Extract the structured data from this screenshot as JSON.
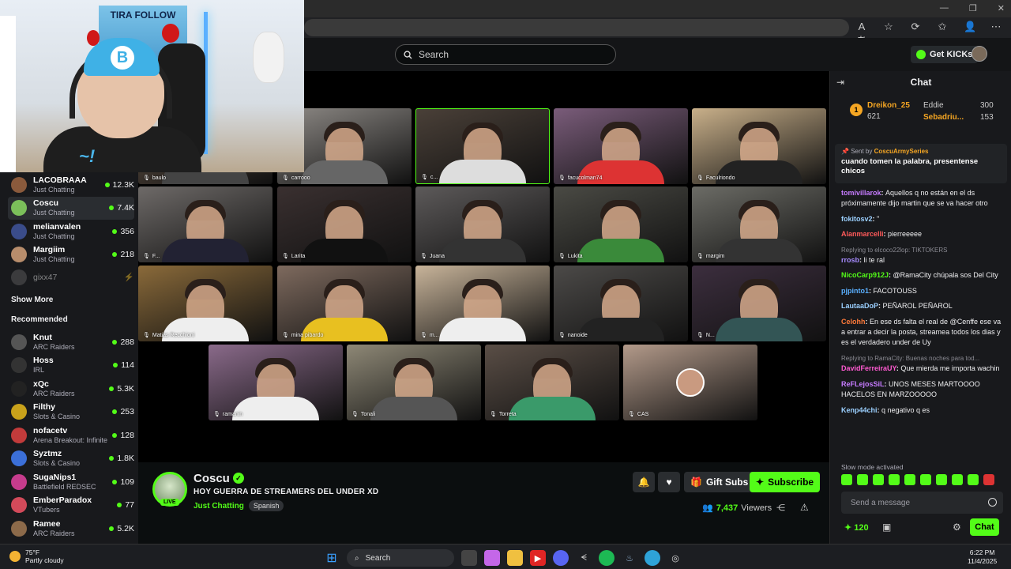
{
  "browser": {
    "window_controls": [
      "—",
      "❐",
      "✕"
    ],
    "icons": [
      "Aあ",
      "☆",
      "⟳",
      "✩",
      "👤",
      "⋯"
    ]
  },
  "topbar": {
    "search_placeholder": "Search",
    "get_kicks": "Get KICKs"
  },
  "webcam": {
    "banner": "TIRA FOLLOW",
    "cap_letter": "B"
  },
  "sidebar": {
    "following": [
      {
        "name": "LACOBRAAA",
        "category": "Just Chatting",
        "viewers": "12.3K",
        "color": "#8a5a3c"
      },
      {
        "name": "Coscu",
        "category": "Just Chatting",
        "viewers": "7.4K",
        "color": "#7bbf5a",
        "active": true
      },
      {
        "name": "melianvalen",
        "category": "Just Chatting",
        "viewers": "356",
        "color": "#3a4c8a"
      },
      {
        "name": "Margiim",
        "category": "Just Chatting",
        "viewers": "218",
        "color": "#b88d6c"
      }
    ],
    "offline": {
      "name": "gixx47"
    },
    "show_more": "Show More",
    "recommended_label": "Recommended",
    "recommended": [
      {
        "name": "Knut",
        "category": "ARC Raiders",
        "viewers": "288",
        "color": "#555"
      },
      {
        "name": "Hoss",
        "category": "IRL",
        "viewers": "114",
        "color": "#333"
      },
      {
        "name": "xQc",
        "category": "ARC Raiders",
        "viewers": "5.3K",
        "color": "#222"
      },
      {
        "name": "Filthy",
        "category": "Slots & Casino",
        "viewers": "253",
        "color": "#c9a21b"
      },
      {
        "name": "nofacetv",
        "category": "Arena Breakout: Infinite",
        "viewers": "128",
        "color": "#c23b3b"
      },
      {
        "name": "Syztmz",
        "category": "Slots & Casino",
        "viewers": "1.8K",
        "color": "#3b6fd8"
      },
      {
        "name": "SugaNips1",
        "category": "Battlefield REDSEC",
        "viewers": "109",
        "color": "#c63c8d"
      },
      {
        "name": "EmberParadox",
        "category": "VTubers",
        "viewers": "77",
        "color": "#d24a5a"
      },
      {
        "name": "Ramee",
        "category": "ARC Raiders",
        "viewers": "5.2K",
        "color": "#8c6a4a"
      }
    ]
  },
  "call": {
    "participants": [
      "baulo",
      "carrooo",
      "c...",
      "facucolman74",
      "Faculriondo",
      "F...",
      "Larita",
      "Juana",
      "Lukita",
      "margim",
      "Matias Recchioni",
      "mina pibardo",
      "m...",
      "nanoide",
      "N...",
      "ramanin",
      "Tonali",
      "Torreta",
      "CAS"
    ]
  },
  "stream": {
    "channel": "Coscu",
    "live": "LIVE",
    "title": "HOY GUERRA DE STREAMERS DEL UNDER XD",
    "category": "Just Chatting",
    "language": "Spanish",
    "gift_subs": "Gift Subs",
    "subscribe": "Subscribe",
    "viewers": "7,437",
    "viewers_label": "Viewers"
  },
  "chat": {
    "title": "Chat",
    "leaderboard": [
      {
        "name": "Dreikon_25",
        "value": "621",
        "color": "#f5a623"
      },
      {
        "name": "Eddie",
        "value": "300",
        "color": "#adadb8"
      },
      {
        "name": "Sebadriu...",
        "value": "153",
        "color": "#f5a623"
      }
    ],
    "pinned": {
      "sent_by": "Sent by",
      "author": "CoscuArmySeries",
      "text": "cuando tomen la palabra, presentense chicos"
    },
    "messages": [
      {
        "user": "tomivillarok",
        "color": "#c67bff",
        "text": "Aquellos q no están en el ds próximamente dijo martin que se va hacer otro"
      },
      {
        "user": "fokitosv2",
        "color": "#9bd0ff",
        "text": "\""
      },
      {
        "user": "Alanmarcelli",
        "color": "#ff5a5a",
        "text": "pierreeeee"
      },
      {
        "reply": "Replying to elcoco22lop: TIKTOKERS",
        "user": "rrosb",
        "color": "#a78bff",
        "text": "li te ral"
      },
      {
        "user": "NicoCarp912J",
        "color": "#53fc18",
        "text": "@RamaCity chúpala sos Del City"
      },
      {
        "user": "pjpinto1",
        "color": "#5ab0ff",
        "text": "FACOTOUSS"
      },
      {
        "user": "LautaaDoP",
        "color": "#9bd0ff",
        "text": "PEÑAROL PEÑAROL"
      },
      {
        "user": "Celohh",
        "color": "#ff7a3a",
        "text": "En ese ds falta el real de @Cenffe ese va a entrar a decir la posta, streamea todos los dias y es el verdadero under de Uy"
      },
      {
        "reply": "Replying to RamaCity: Buenas noches para tod...",
        "user": "DavidFerreiraUY",
        "color": "#ff5ad1",
        "text": "Que mierda me importa wachin"
      },
      {
        "user": "ReFLejosSiL",
        "color": "#c67bff",
        "text": "UNOS MESES MARTOOOO HACELOS EN MARZOOOOO"
      },
      {
        "user": "Kenp44chi",
        "color": "#9bd0ff",
        "text": "q negativo q es"
      }
    ],
    "slow_mode": "Slow mode activated",
    "send_placeholder": "Send a message",
    "points": "120",
    "chat_button": "Chat"
  },
  "taskbar": {
    "temp": "75°F",
    "condition": "Partly cloudy",
    "search": "Search",
    "time": "6:22 PM",
    "date": "11/4/2025"
  }
}
